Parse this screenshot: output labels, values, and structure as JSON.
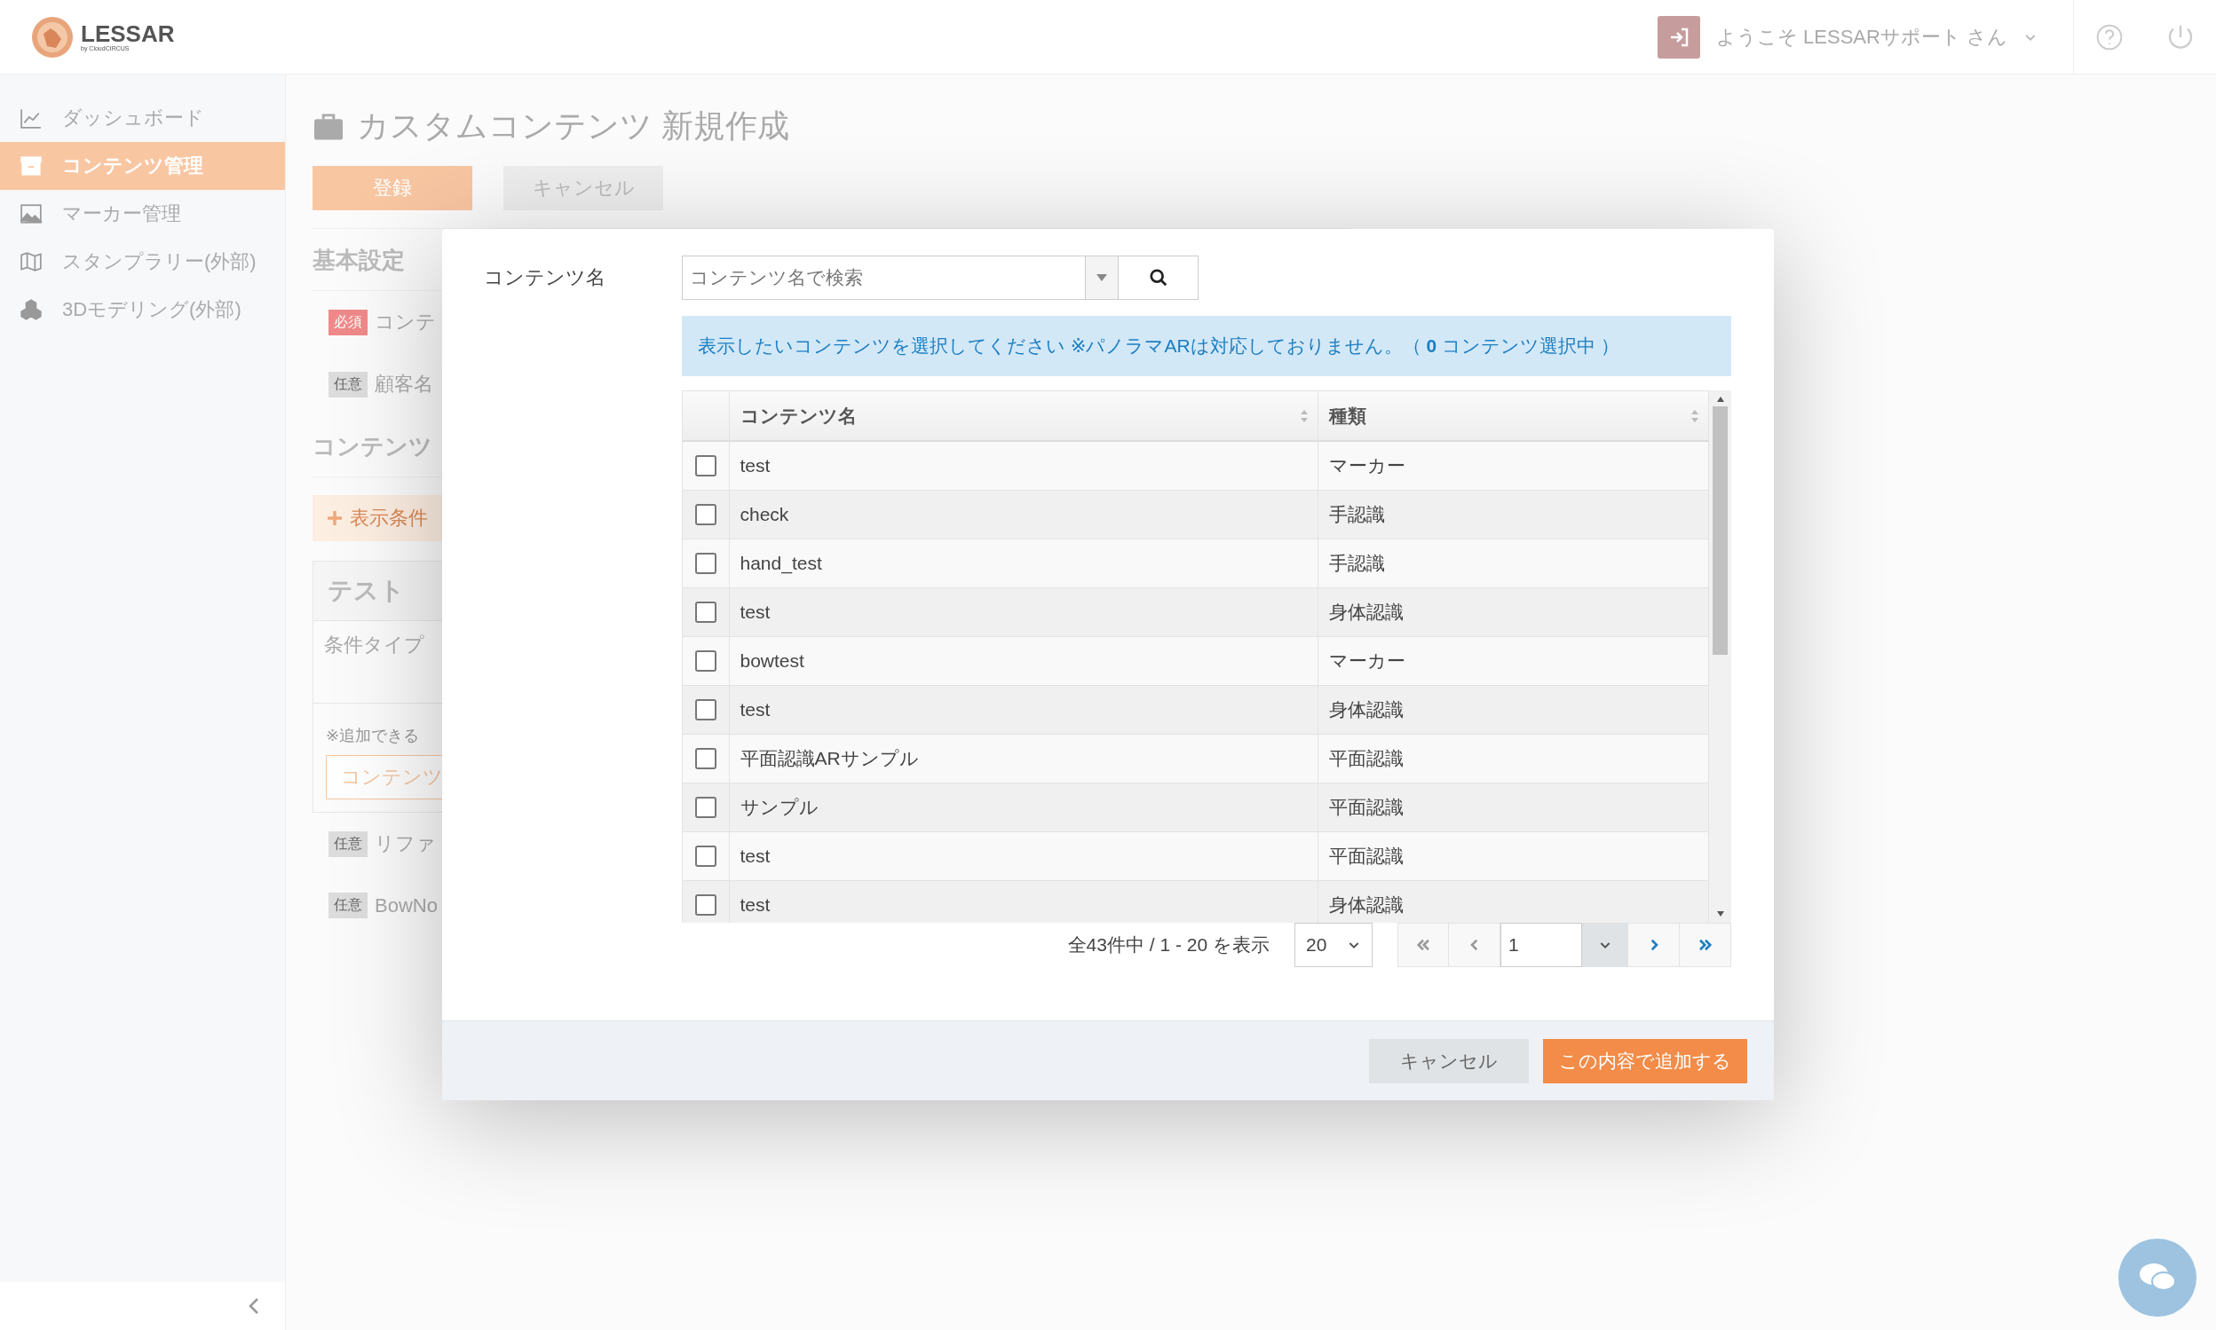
{
  "header": {
    "logo": "LESSAR",
    "logo_sub": "by CloudCIRCUS",
    "greeting": "ようこそ LESSARサポート さん"
  },
  "sidebar": {
    "items": [
      {
        "label": "ダッシュボード",
        "kind": "chart",
        "selected": false
      },
      {
        "label": "コンテンツ管理",
        "kind": "box",
        "selected": true
      },
      {
        "label": "マーカー管理",
        "kind": "image",
        "selected": false
      },
      {
        "label": "スタンプラリー(外部)",
        "kind": "map",
        "selected": false
      },
      {
        "label": "3Dモデリング(外部)",
        "kind": "cubes",
        "selected": false
      }
    ]
  },
  "page": {
    "title": "カスタムコンテンツ 新規作成",
    "buttons": [
      {
        "label": "登録",
        "kind": "primary"
      },
      {
        "label": "キャンセル",
        "kind": "secondary"
      }
    ],
    "section1": "基本設定",
    "fields": [
      {
        "badge": "必須",
        "required": true,
        "label": "コンテ"
      },
      {
        "badge": "任意",
        "required": false,
        "label": "顧客名"
      }
    ],
    "section2": "コンテンツ",
    "add_condition": "表示条件",
    "card": {
      "title": "テスト",
      "row_label": "条件タイプ",
      "note": "※追加できる",
      "button": "コンテンツ"
    },
    "fields2": [
      {
        "badge": "任意",
        "required": false,
        "label": "リファ"
      },
      {
        "badge": "任意",
        "required": false,
        "label": "BowNo"
      }
    ]
  },
  "modal": {
    "field_label": "コンテンツ名",
    "search": {
      "placeholder": "コンテンツ名で検索"
    },
    "notice": "表示したいコンテンツを選択してください ※パノラマARは対応しておりません。（ **0** コンテンツ選択中 ）",
    "table": {
      "columns": [
        "コンテンツ名",
        "種類"
      ],
      "rows": [
        {
          "name": "test",
          "type": "マーカー",
          "checked": false
        },
        {
          "name": "check",
          "type": "手認識",
          "checked": false
        },
        {
          "name": "hand_test",
          "type": "手認識",
          "checked": false
        },
        {
          "name": "test",
          "type": "身体認識",
          "checked": false
        },
        {
          "name": "bowtest",
          "type": "マーカー",
          "checked": false
        },
        {
          "name": "test",
          "type": "身体認識",
          "checked": false
        },
        {
          "name": "平面認識ARサンプル",
          "type": "平面認識",
          "checked": false
        },
        {
          "name": "サンプル",
          "type": "平面認識",
          "checked": false
        },
        {
          "name": "test",
          "type": "平面認識",
          "checked": false
        },
        {
          "name": "test",
          "type": "身体認識",
          "checked": false
        }
      ]
    },
    "summary": "全43件中 / 1 - 20 を表示",
    "page_size": "20",
    "page": "1",
    "pager": [
      {
        "kind": "first",
        "disabled": true
      },
      {
        "kind": "prev",
        "disabled": true
      },
      {
        "kind": "next",
        "disabled": false
      },
      {
        "kind": "last",
        "disabled": false
      }
    ],
    "buttons": [
      {
        "label": "キャンセル",
        "kind": "secondary"
      },
      {
        "label": "この内容で追加する",
        "kind": "primary"
      }
    ]
  }
}
